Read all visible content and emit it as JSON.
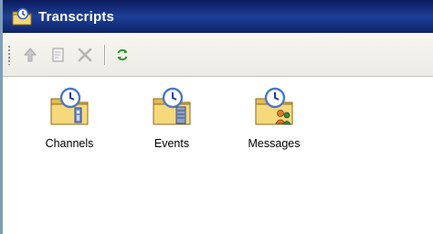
{
  "window": {
    "title": "Transcripts",
    "icon": "transcripts-folder-icon"
  },
  "toolbar": {
    "buttons": [
      {
        "name": "up-button",
        "icon": "up-arrow-icon",
        "enabled": false
      },
      {
        "name": "properties-button",
        "icon": "properties-page-icon",
        "enabled": false
      },
      {
        "name": "delete-button",
        "icon": "delete-x-icon",
        "enabled": false
      },
      {
        "name": "refresh-button",
        "icon": "refresh-icon",
        "enabled": true
      }
    ]
  },
  "items": [
    {
      "label": "Channels",
      "icon": "channels-folder-icon"
    },
    {
      "label": "Events",
      "icon": "events-folder-icon"
    },
    {
      "label": "Messages",
      "icon": "messages-folder-icon"
    }
  ],
  "colors": {
    "titlebar": "#1d3f98",
    "folder": "#f2d06b",
    "clock": "#4a78c8"
  }
}
